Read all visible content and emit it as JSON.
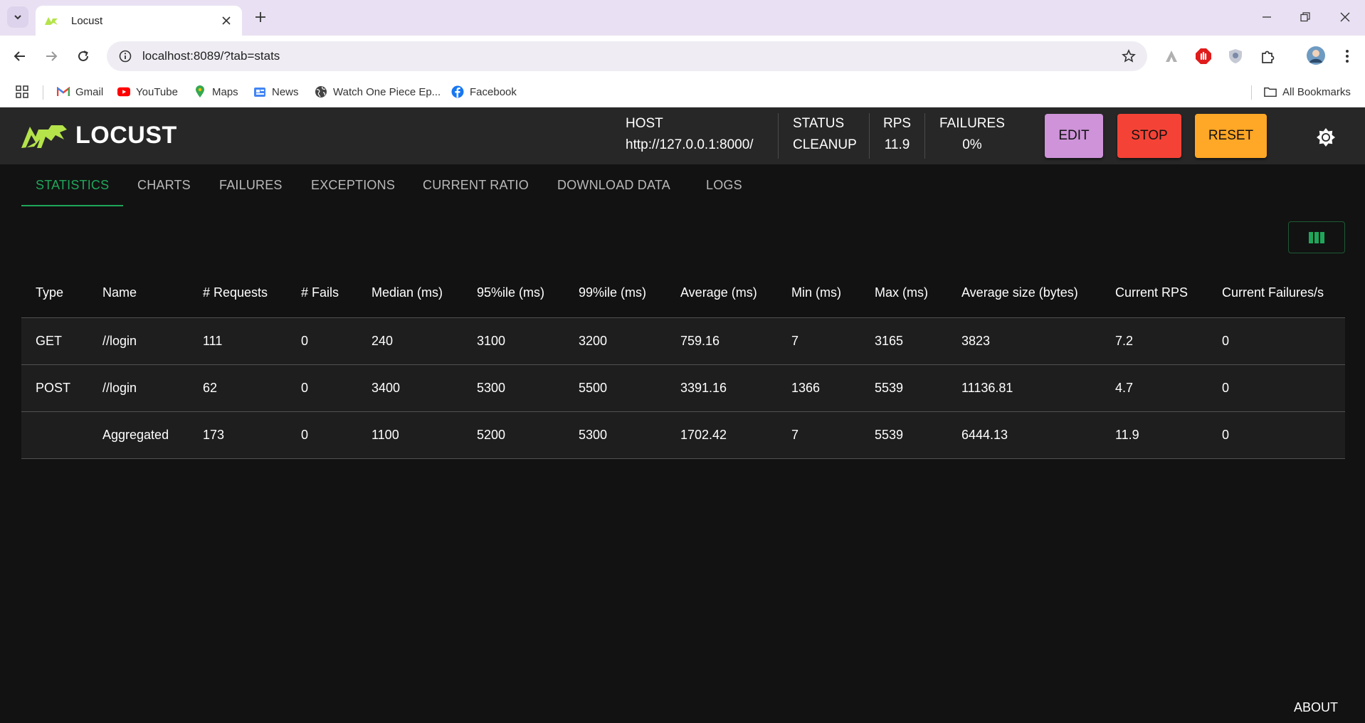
{
  "browser": {
    "tab_title": "Locust",
    "url_host": "localhost",
    "url_rest": ":8089/?tab=stats",
    "bookmarks": [
      {
        "label": "Gmail",
        "icon": "gmail-icon"
      },
      {
        "label": "YouTube",
        "icon": "youtube-icon"
      },
      {
        "label": "Maps",
        "icon": "maps-icon"
      },
      {
        "label": "News",
        "icon": "news-icon"
      },
      {
        "label": "Watch One Piece Ep...",
        "icon": "globe-icon"
      },
      {
        "label": "Facebook",
        "icon": "facebook-icon"
      }
    ],
    "all_bookmarks": "All Bookmarks"
  },
  "app": {
    "brand": "LOCUST",
    "host_label": "HOST",
    "host_value": "http://127.0.0.1:8000/",
    "status_label": "STATUS",
    "status_value": "CLEANUP",
    "rps_label": "RPS",
    "rps_value": "11.9",
    "failures_label": "FAILURES",
    "failures_value": "0%",
    "edit_label": "EDIT",
    "stop_label": "STOP",
    "reset_label": "RESET",
    "accent_color": "#1fa65a",
    "logo_color": "#b4e34a"
  },
  "tabs": [
    "STATISTICS",
    "CHARTS",
    "FAILURES",
    "EXCEPTIONS",
    "CURRENT RATIO",
    "DOWNLOAD DATA",
    "LOGS"
  ],
  "active_tab": "STATISTICS",
  "table": {
    "headers": [
      "Type",
      "Name",
      "# Requests",
      "# Fails",
      "Median (ms)",
      "95%ile (ms)",
      "99%ile (ms)",
      "Average (ms)",
      "Min (ms)",
      "Max (ms)",
      "Average size (bytes)",
      "Current RPS",
      "Current Failures/s"
    ],
    "rows": [
      [
        "GET",
        "//login",
        "111",
        "0",
        "240",
        "3100",
        "3200",
        "759.16",
        "7",
        "3165",
        "3823",
        "7.2",
        "0"
      ],
      [
        "POST",
        "//login",
        "62",
        "0",
        "3400",
        "5300",
        "5500",
        "3391.16",
        "1366",
        "5539",
        "11136.81",
        "4.7",
        "0"
      ],
      [
        "",
        "Aggregated",
        "173",
        "0",
        "1100",
        "5200",
        "5300",
        "1702.42",
        "7",
        "5539",
        "6444.13",
        "11.9",
        "0"
      ]
    ]
  },
  "footer": {
    "about": "ABOUT"
  }
}
